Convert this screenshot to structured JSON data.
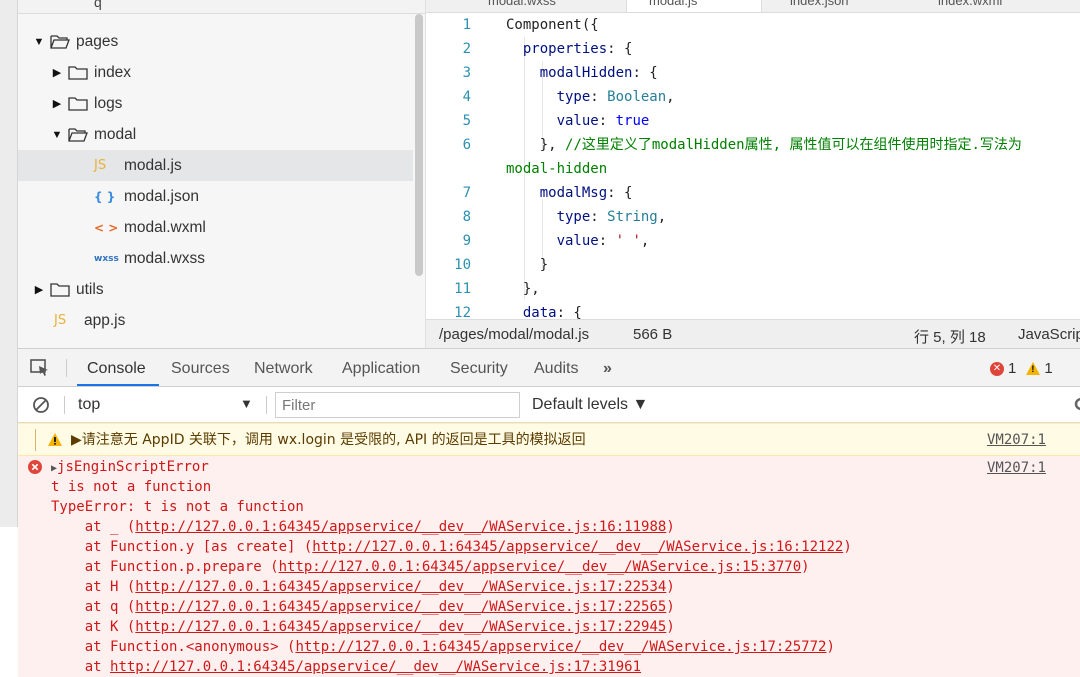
{
  "explorer": {
    "top_fragment": "q",
    "items": [
      {
        "label": "pages",
        "kind": "folder",
        "expanded": true,
        "depth": 0
      },
      {
        "label": "index",
        "kind": "folder",
        "expanded": false,
        "depth": 1
      },
      {
        "label": "logs",
        "kind": "folder",
        "expanded": false,
        "depth": 1
      },
      {
        "label": "modal",
        "kind": "folder",
        "expanded": true,
        "depth": 1
      },
      {
        "label": "modal.js",
        "kind": "file",
        "icon": "JS",
        "depth": 2,
        "selected": true
      },
      {
        "label": "modal.json",
        "kind": "file",
        "icon": "{ }",
        "depth": 2
      },
      {
        "label": "modal.wxml",
        "kind": "file",
        "icon": "< >",
        "depth": 2
      },
      {
        "label": "modal.wxss",
        "kind": "file",
        "icon": "wxss",
        "depth": 2
      },
      {
        "label": "utils",
        "kind": "folder",
        "expanded": false,
        "depth": 0
      },
      {
        "label": "app.js",
        "kind": "file",
        "icon": "JS",
        "depth": 0
      }
    ]
  },
  "editor": {
    "tabs": [
      "modal.wxss",
      "modal.js",
      "index.json",
      "index.wxml"
    ],
    "active_tab": "modal.js",
    "lines": [
      {
        "n": "1",
        "text": "Component({"
      },
      {
        "n": "2",
        "text": "  properties: {"
      },
      {
        "n": "3",
        "text": "    modalHidden: {"
      },
      {
        "n": "4",
        "text": "      type: Boolean,"
      },
      {
        "n": "5",
        "text": "      value: true"
      },
      {
        "n": "6",
        "text": "    }, //这里定义了modalHidden属性, 属性值可以在组件使用时指定.写法为"
      },
      {
        "n": "",
        "text": "modal-hidden"
      },
      {
        "n": "7",
        "text": "    modalMsg: {"
      },
      {
        "n": "8",
        "text": "      type: String,"
      },
      {
        "n": "9",
        "text": "      value: ' ',"
      },
      {
        "n": "10",
        "text": "    }"
      },
      {
        "n": "11",
        "text": "  },"
      },
      {
        "n": "12",
        "text": "  data: {"
      }
    ],
    "status": {
      "path": "/pages/modal/modal.js",
      "size": "566 B",
      "position": "行 5, 列 18",
      "language": "JavaScript"
    }
  },
  "devtools": {
    "tabs": [
      "Console",
      "Sources",
      "Network",
      "Application",
      "Security",
      "Audits",
      "»"
    ],
    "active_tab": "Console",
    "error_count": "1",
    "warning_count": "1",
    "context": "top",
    "filter_placeholder": "Filter",
    "levels": "Default levels ▼",
    "messages": {
      "warning": {
        "text": "▶请注意无 AppID 关联下，调用 wx.login 是受限的, API 的返回是工具的模拟返回",
        "source": "VM207:1"
      },
      "error": {
        "source": "VM207:1",
        "lines": [
          "▶jsEnginScriptError",
          "t is not a function",
          "TypeError: t is not a function",
          "    at _ (http://127.0.0.1:64345/appservice/__dev__/WAService.js:16:11988)",
          "    at Function.y [as create] (http://127.0.0.1:64345/appservice/__dev__/WAService.js:16:12122)",
          "    at Function.p.prepare (http://127.0.0.1:64345/appservice/__dev__/WAService.js:15:3770)",
          "    at H (http://127.0.0.1:64345/appservice/__dev__/WAService.js:17:22534)",
          "    at q (http://127.0.0.1:64345/appservice/__dev__/WAService.js:17:22565)",
          "    at K (http://127.0.0.1:64345/appservice/__dev__/WAService.js:17:22945)",
          "    at Function.<anonymous> (http://127.0.0.1:64345/appservice/__dev__/WAService.js:17:25772)",
          "    at http://127.0.0.1:64345/appservice/__dev__/WAService.js:17:31961"
        ]
      }
    }
  },
  "colors": {
    "link_blue": "#1a73e8",
    "error_red": "#d01818",
    "warning_bg": "#fffbe5",
    "error_bg": "#fff0f0"
  }
}
